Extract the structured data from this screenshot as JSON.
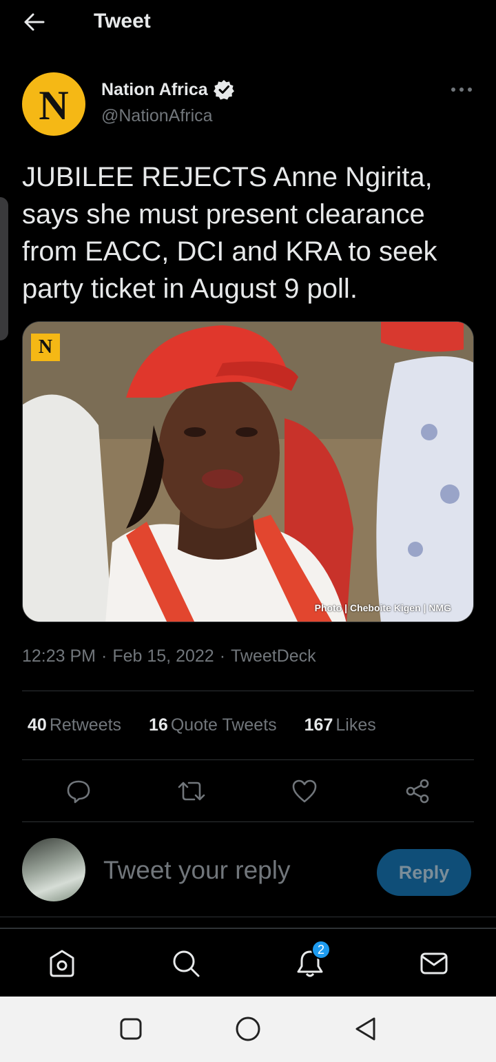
{
  "header": {
    "title": "Tweet",
    "back_icon": "arrow-left-icon"
  },
  "author": {
    "avatar_letter": "N",
    "display_name": "Nation Africa",
    "handle": "@NationAfrica",
    "verified": true,
    "brand_color": "#f5b815"
  },
  "tweet": {
    "text": "JUBILEE REJECTS Anne Ngirita, says she must present clearance from EACC, DCI and KRA to seek party ticket in August 9 poll.",
    "photo": {
      "badge_letter": "N",
      "credit": "Photo | Cheboite Kigen | NMG"
    },
    "time": "12:23 PM",
    "date": "Feb 15, 2022",
    "source": "TweetDeck",
    "separator": "·"
  },
  "stats": [
    {
      "count": "40",
      "label": "Retweets"
    },
    {
      "count": "16",
      "label": "Quote Tweets"
    },
    {
      "count": "167",
      "label": "Likes"
    }
  ],
  "actions": [
    "reply-icon",
    "retweet-icon",
    "like-icon",
    "share-icon"
  ],
  "reply": {
    "placeholder": "Tweet your reply",
    "button_label": "Reply"
  },
  "bottom_nav": {
    "items": [
      "home-icon",
      "search-icon",
      "notifications-icon",
      "messages-icon"
    ],
    "notification_count": "2"
  },
  "android_nav": [
    "recents-icon",
    "home-circle-icon",
    "back-triangle-icon"
  ],
  "colors": {
    "accent": "#1d9bf0",
    "reply_button": "#0f4e78",
    "muted_text": "#71767b"
  }
}
